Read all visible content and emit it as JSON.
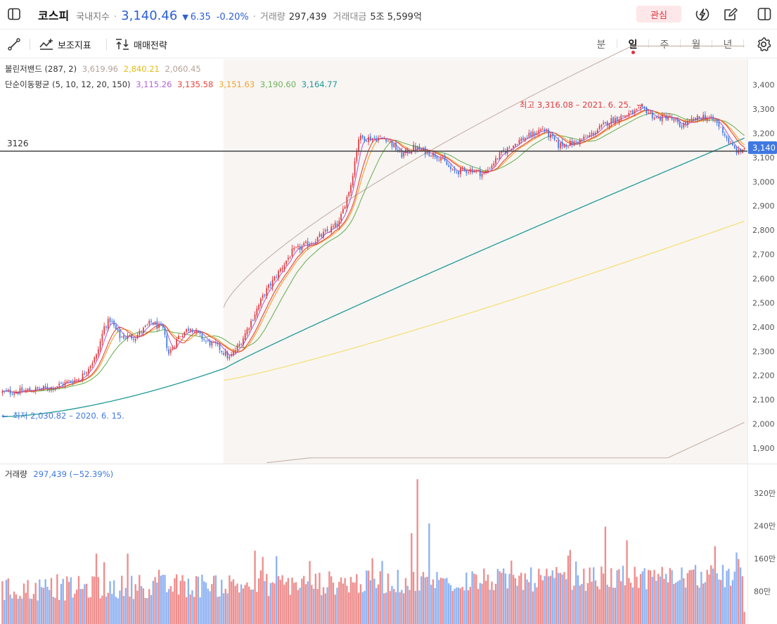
{
  "header": {
    "name": "코스피",
    "category": "국내지수",
    "price": "3,140.46",
    "change": "6.35",
    "change_pct": "-0.20%",
    "volume_label": "거래량",
    "volume": "297,439",
    "amount_label": "거래대금",
    "amount": "5조 5,599억",
    "interest_label": "관심"
  },
  "toolbar": {
    "indicator_label": "보조지표",
    "strategy_label": "매매전략",
    "periods": [
      "분",
      "일",
      "주",
      "월",
      "년"
    ],
    "active_period": "일"
  },
  "legend": {
    "bollinger": {
      "label": "볼린저밴드 (287, 2)",
      "values": [
        "3,619.96",
        "2,840.21",
        "2,060.45"
      ]
    },
    "sma": {
      "label": "단순이동평균 (5, 10, 12, 20, 150)",
      "values": [
        "3,115.26",
        "3,135.58",
        "3,151.63",
        "3,190.60",
        "3,164.77"
      ]
    }
  },
  "annotations": {
    "high": "최고 3,316.08 – 2021. 6. 25.",
    "low": "최저 2,030.82 – 2020. 6. 15.",
    "hline_label": "3126",
    "last_price": "3,140"
  },
  "volume_legend": {
    "label": "거래량",
    "value": "297,439 (−52.39%)"
  },
  "colors": {
    "up": "#e03a3e",
    "down": "#3f78e0",
    "vol_up": "#ee8e8e",
    "vol_down": "#8fb3f2",
    "bb_upper": "#c9b6ad",
    "bb_mid": "#f5e071",
    "ma5": "#b065d6",
    "ma10": "#e8453c",
    "ma12": "#f0a32c",
    "ma20": "#6fb35a",
    "ma150": "#1f9a96"
  },
  "chart_data": [
    {
      "type": "candlestick",
      "title": "코스피",
      "yticks": [
        "3,400",
        "3,300",
        "3,200",
        "3,100",
        "3,000",
        "2,900",
        "2,800",
        "2,700",
        "2,600",
        "2,500",
        "2,400",
        "2,300",
        "2,200",
        "2,100",
        "2,000",
        "1,900"
      ],
      "ylim": [
        1840,
        3400
      ],
      "last_close": 3140.46,
      "high": 3316.08,
      "low": 2030.82,
      "horizontal_line": 3126,
      "anchors": [
        [
          0,
          2130
        ],
        [
          10,
          2135
        ],
        [
          25,
          2150
        ],
        [
          40,
          2190
        ],
        [
          48,
          2280
        ],
        [
          52,
          2400
        ],
        [
          55,
          2430
        ],
        [
          60,
          2360
        ],
        [
          68,
          2360
        ],
        [
          76,
          2420
        ],
        [
          82,
          2390
        ],
        [
          85,
          2290
        ],
        [
          90,
          2360
        ],
        [
          96,
          2400
        ],
        [
          104,
          2340
        ],
        [
          110,
          2320
        ],
        [
          116,
          2270
        ],
        [
          122,
          2340
        ],
        [
          134,
          2540
        ],
        [
          148,
          2710
        ],
        [
          160,
          2760
        ],
        [
          172,
          2830
        ],
        [
          178,
          2990
        ],
        [
          182,
          3180
        ],
        [
          196,
          3180
        ],
        [
          204,
          3110
        ],
        [
          210,
          3140
        ],
        [
          218,
          3120
        ],
        [
          224,
          3100
        ],
        [
          230,
          3040
        ],
        [
          240,
          3050
        ],
        [
          246,
          3030
        ],
        [
          254,
          3110
        ],
        [
          264,
          3170
        ],
        [
          272,
          3200
        ],
        [
          276,
          3220
        ],
        [
          284,
          3150
        ],
        [
          292,
          3160
        ],
        [
          300,
          3190
        ],
        [
          310,
          3250
        ],
        [
          320,
          3280
        ],
        [
          328,
          3300
        ],
        [
          334,
          3260
        ],
        [
          340,
          3270
        ],
        [
          346,
          3230
        ],
        [
          352,
          3250
        ],
        [
          358,
          3270
        ],
        [
          364,
          3250
        ],
        [
          368,
          3210
        ],
        [
          372,
          3150
        ],
        [
          376,
          3120
        ],
        [
          379,
          3140
        ]
      ]
    },
    {
      "type": "bar",
      "title": "거래량",
      "yticks": [
        "320만",
        "240만",
        "160만",
        "80만"
      ],
      "ylim": [
        0,
        3600000
      ],
      "last_value": 297439
    }
  ]
}
